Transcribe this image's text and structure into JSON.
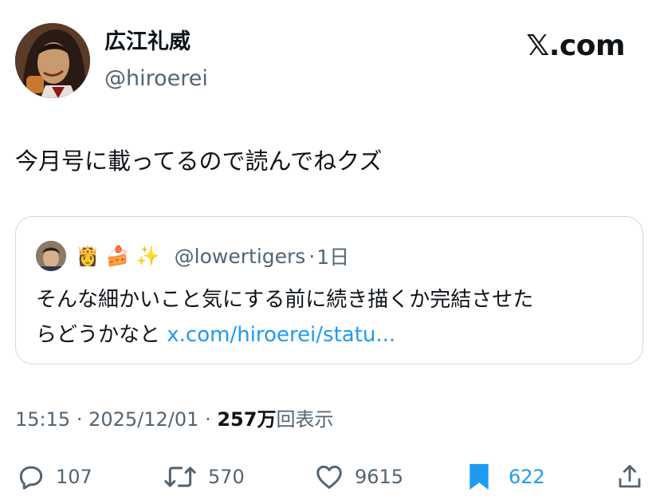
{
  "author": {
    "display_name": "広江礼威",
    "handle": "@hiroerei"
  },
  "brand": {
    "logo_text": "𝕏.com"
  },
  "tweet": {
    "text": "今月号に載ってるので読んでねクズ"
  },
  "quoted_tweet": {
    "emojis": [
      "👸",
      "🍰",
      "✨"
    ],
    "handle": "@lowertigers",
    "separator": "·",
    "age": "1日",
    "text_line1": "そんな細かいこと気にする前に続き描くか完結させた",
    "text_line2": "らどうかなと",
    "link_text": "x.com/hiroerei/statu..."
  },
  "meta": {
    "time": "15:15",
    "sep1": "·",
    "date": "2025/12/01",
    "sep2": "·",
    "views_count": "257万",
    "views_label": "回表示"
  },
  "actions": {
    "replies": "107",
    "reposts": "570",
    "likes": "9615",
    "bookmarks": "622"
  },
  "colors": {
    "accent": "#1d9bf0",
    "secondary_text": "#536471",
    "border": "#cfd9de"
  }
}
